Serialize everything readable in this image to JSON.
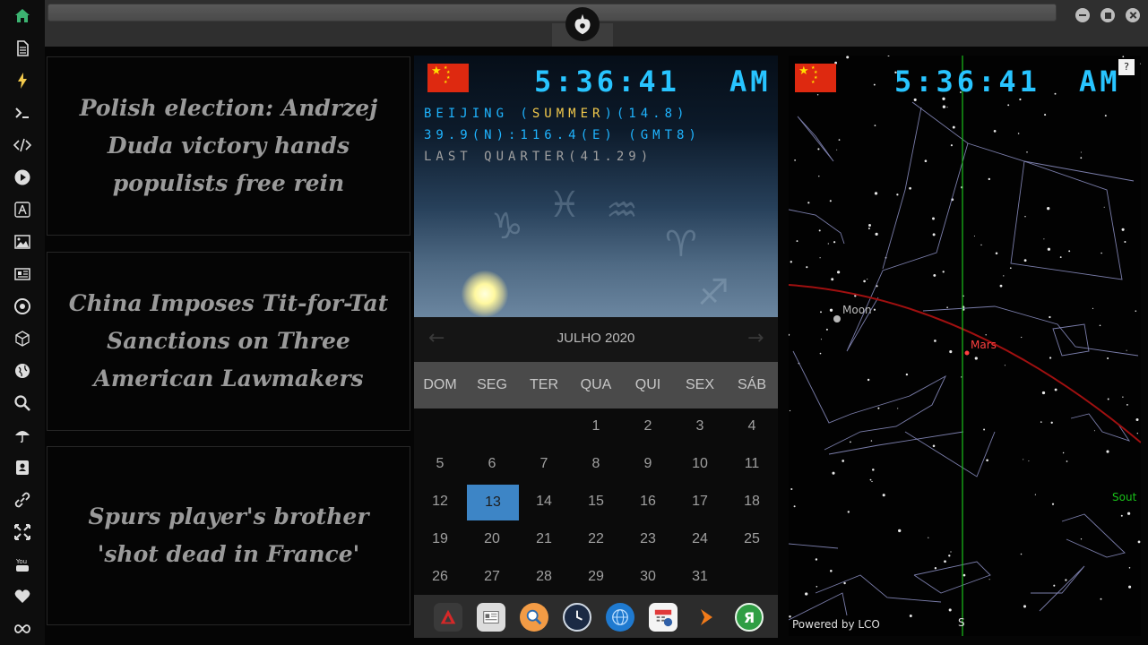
{
  "sidebar": {
    "icons": [
      "home-icon",
      "document-icon",
      "bolt-icon",
      "terminal-icon",
      "code-icon",
      "play-icon",
      "translate-icon",
      "image-icon",
      "newspaper-icon",
      "settings-wheel-icon",
      "cube-icon",
      "globe-icon",
      "search-icon",
      "umbrella-icon",
      "contacts-icon",
      "link-icon",
      "fullscreen-icon",
      "youtube-icon",
      "heart-icon",
      "infinity-icon"
    ]
  },
  "news": [
    {
      "headline": "Polish election: Andrzej Duda victory hands populists free rein"
    },
    {
      "headline": "China Imposes Tit-for-Tat Sanctions on Three American Lawmakers"
    },
    {
      "headline": "Spurs player's brother 'shot dead in France'"
    }
  ],
  "clock": {
    "time": "5:36:41",
    "ampm": "AM",
    "line1_city": "BEIJING (",
    "line1_season": "SUMMER",
    "line1_rest": ")(14.8)",
    "line2": "39.9(N):116.4(E) (GMT8)",
    "line3": "LAST QUARTER(41.29)"
  },
  "calendar": {
    "month": "JULHO 2020",
    "prev": "←",
    "next": "→",
    "weekdays": [
      "DOM",
      "SEG",
      "TER",
      "QUA",
      "QUI",
      "SEX",
      "SÁB"
    ],
    "weeks": [
      [
        "",
        "",
        "",
        "1",
        "2",
        "3",
        "4"
      ],
      [
        "5",
        "6",
        "7",
        "8",
        "9",
        "10",
        "11"
      ],
      [
        "12",
        "13",
        "14",
        "15",
        "16",
        "17",
        "18"
      ],
      [
        "19",
        "20",
        "21",
        "22",
        "23",
        "24",
        "25"
      ],
      [
        "26",
        "27",
        "28",
        "29",
        "30",
        "31",
        ""
      ]
    ],
    "today": "13"
  },
  "dock": {
    "icons": [
      "triangle-app-icon",
      "news-app-icon",
      "search-app-icon",
      "clock-app-icon",
      "globe-app-icon",
      "calendar-app-icon",
      "arrow-app-icon",
      "yandex-app-icon"
    ]
  },
  "skymap": {
    "time": "5:36:41",
    "ampm": "AM",
    "help": "?",
    "moon_label": "Moon",
    "mars_label": "Mars",
    "south_label": "Sout",
    "s_label": "S",
    "powered_by": "Powered by LCO"
  },
  "colors": {
    "accent_blue": "#28c4ff",
    "today_blue": "#3d85c6",
    "home_green": "#3cb371",
    "bolt_yellow": "#f2c94c",
    "mars_red": "#ff4040",
    "meridian_green": "#19c019",
    "ecliptic_red": "#a01010"
  }
}
